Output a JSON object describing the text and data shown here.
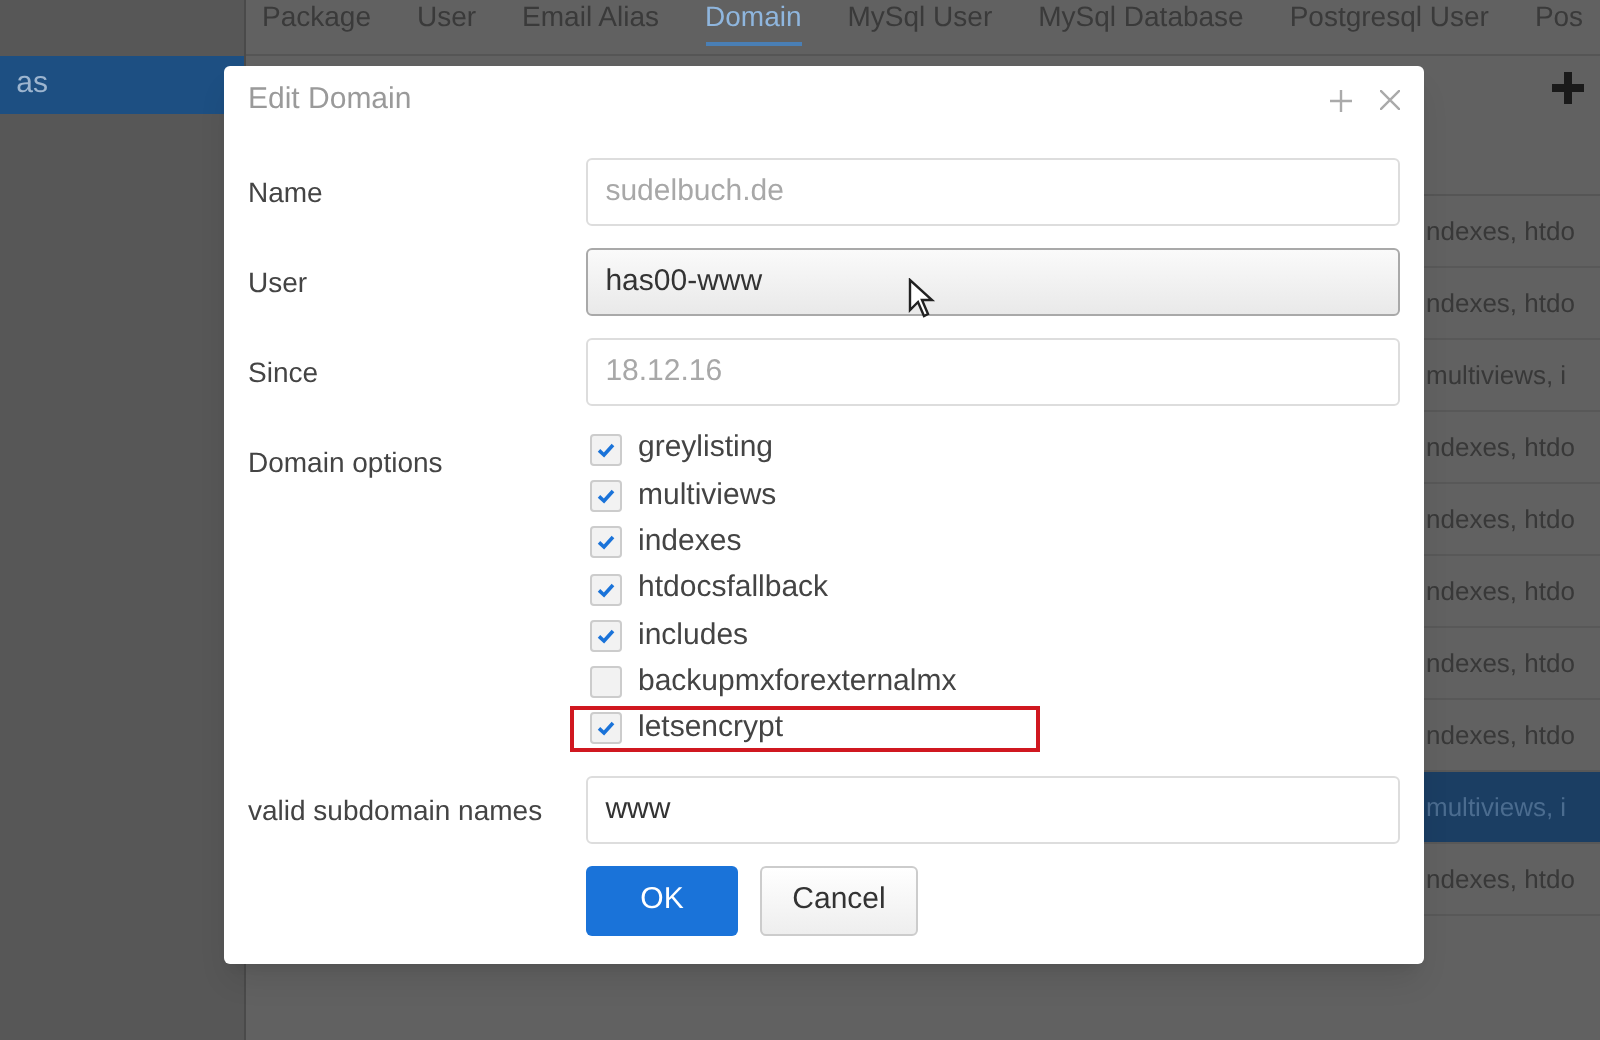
{
  "sidebar": {
    "items": [
      {
        "label": "as",
        "selected": true
      }
    ]
  },
  "tabs": [
    {
      "label": "Package",
      "selected": false
    },
    {
      "label": "User",
      "selected": false
    },
    {
      "label": "Email Alias",
      "selected": false
    },
    {
      "label": "Domain",
      "selected": true
    },
    {
      "label": "MySql User",
      "selected": false
    },
    {
      "label": "MySql Database",
      "selected": false
    },
    {
      "label": "Postgresql User",
      "selected": false
    },
    {
      "label": "Pos",
      "selected": false
    }
  ],
  "table": {
    "rows": [
      {
        "column_1": "ndexes, htdo",
        "selected": false
      },
      {
        "column_1": "ndexes, htdo",
        "selected": false
      },
      {
        "column_1": "multiviews, i",
        "selected": false
      },
      {
        "column_1": "ndexes, htdo",
        "selected": false
      },
      {
        "column_1": "ndexes, htdo",
        "selected": false
      },
      {
        "column_1": "ndexes, htdo",
        "selected": false
      },
      {
        "column_1": "ndexes, htdo",
        "selected": false
      },
      {
        "column_1": "ndexes, htdo",
        "selected": false
      },
      {
        "column_1": "multiviews, i",
        "selected": true
      },
      {
        "column_1": "ndexes, htdo",
        "selected": false
      }
    ]
  },
  "dialog": {
    "title": "Edit Domain",
    "fields": [
      {
        "kind": "text",
        "label": "Name",
        "value": "sudelbuch.de",
        "disabled": true
      },
      {
        "kind": "select",
        "label": "User",
        "value": "has00-www",
        "disabled": false
      },
      {
        "kind": "text",
        "label": "Since",
        "value": "18.12.16",
        "disabled": true
      }
    ],
    "domain_options": {
      "label": "Domain options",
      "options": [
        {
          "label": "greylisting",
          "checked": true,
          "highlighted": false
        },
        {
          "label": "multiviews",
          "checked": true,
          "highlighted": false
        },
        {
          "label": "indexes",
          "checked": true,
          "highlighted": false
        },
        {
          "label": "htdocsfallback",
          "checked": true,
          "highlighted": false
        },
        {
          "label": "includes",
          "checked": true,
          "highlighted": false
        },
        {
          "label": "backupmxforexternalmx",
          "checked": false,
          "highlighted": false
        },
        {
          "label": "letsencrypt",
          "checked": true,
          "highlighted": true
        }
      ]
    },
    "subdomains": {
      "label": "valid subdomain names",
      "value": "www"
    },
    "buttons": [
      {
        "kind": "primary",
        "label": "OK"
      },
      {
        "kind": "secondary",
        "label": "Cancel"
      }
    ]
  }
}
